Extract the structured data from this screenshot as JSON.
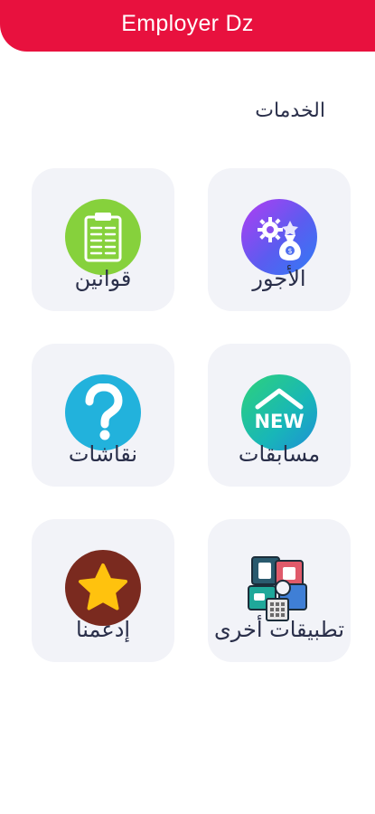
{
  "header": {
    "title": "Employer Dz",
    "color": "#e8113e"
  },
  "section": {
    "title": "الخدمات"
  },
  "services": [
    {
      "label": "الأجور",
      "icon": "salary-gear-money-icon"
    },
    {
      "label": "قوانين",
      "icon": "clipboard-laws-icon"
    },
    {
      "label": "مسابقات",
      "icon": "new-badge-house-icon"
    },
    {
      "label": "نقاشات",
      "icon": "question-mark-icon"
    },
    {
      "label": "تطبيقات أخرى",
      "icon": "other-apps-icon"
    },
    {
      "label": "إدعمنا",
      "icon": "star-support-icon"
    }
  ]
}
